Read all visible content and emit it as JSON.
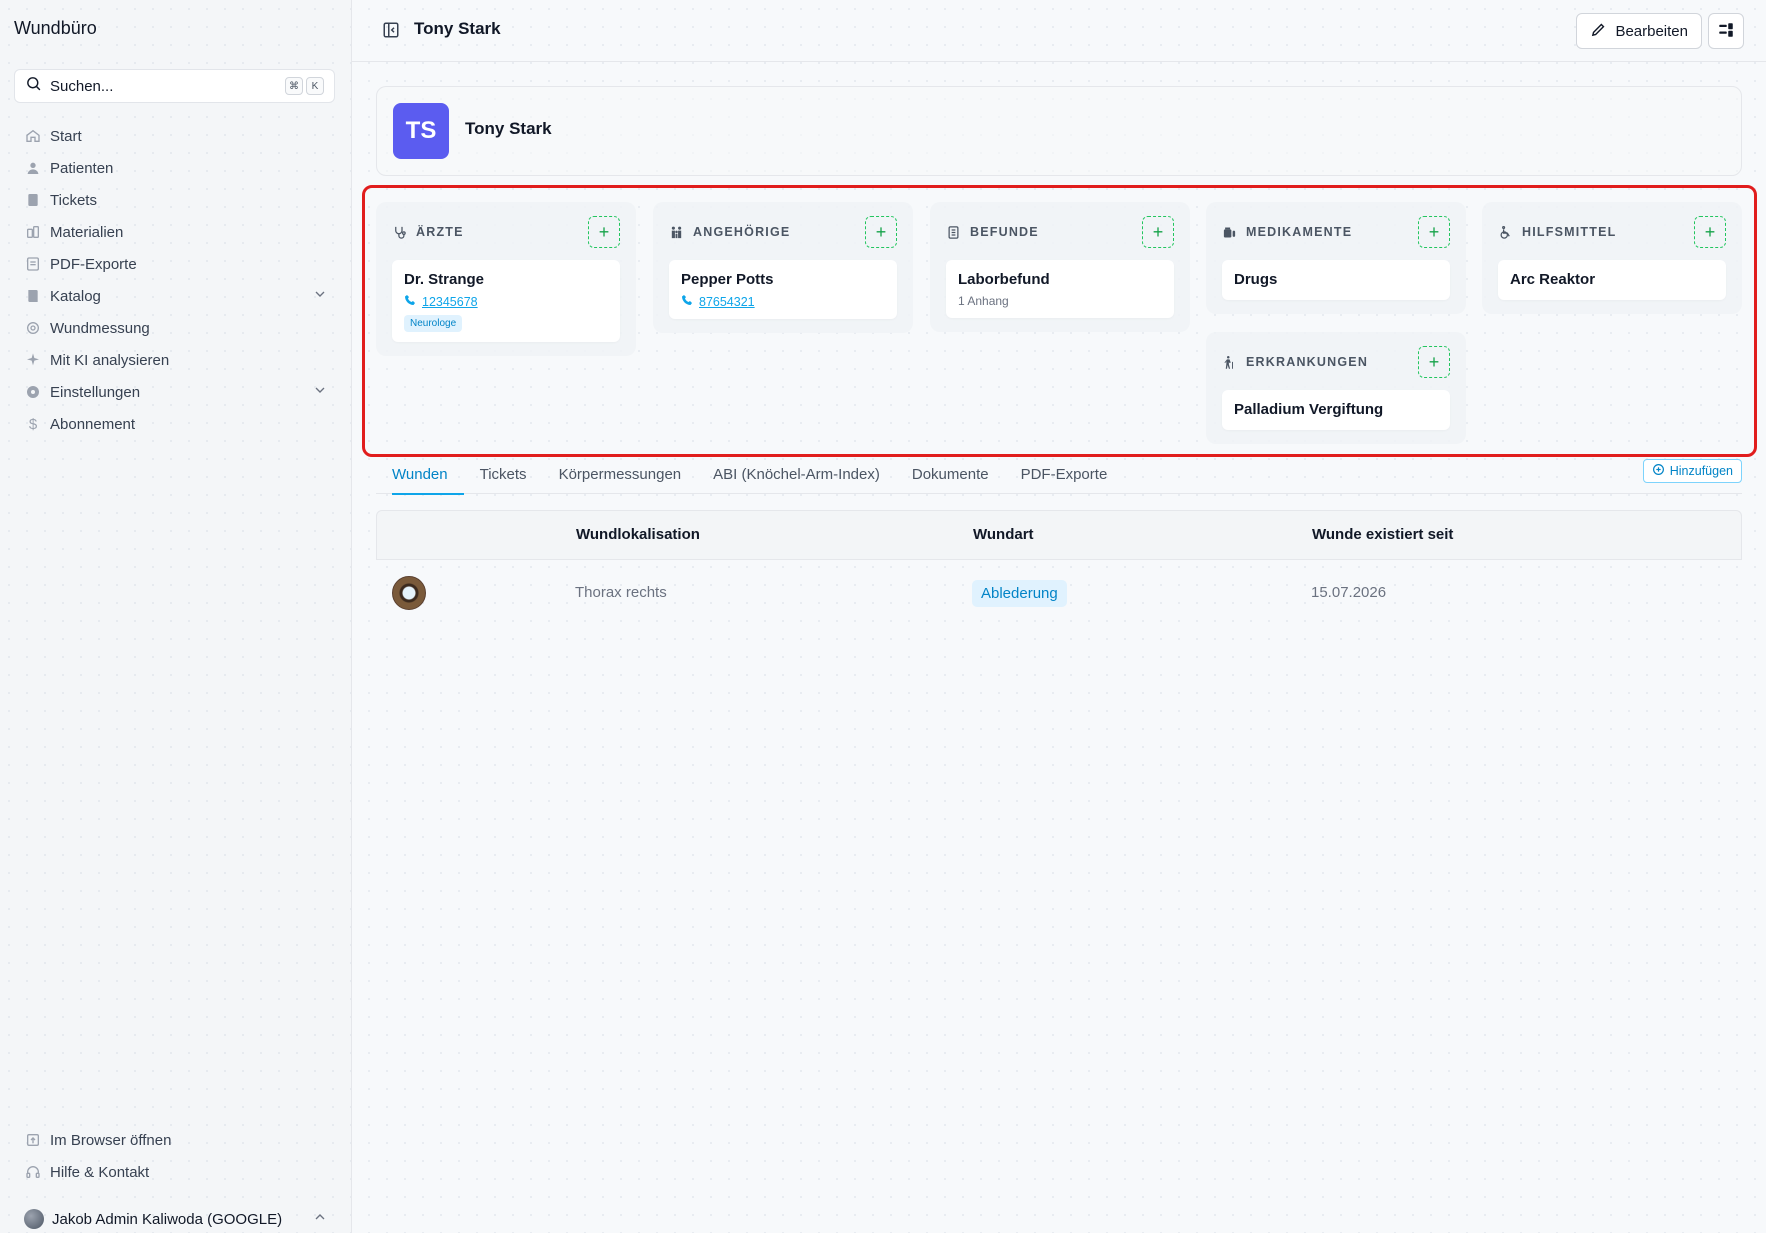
{
  "app": {
    "title": "Wundbüro"
  },
  "search": {
    "placeholder": "Suchen...",
    "shortcut_mod": "⌘",
    "shortcut_key": "K"
  },
  "sidebar": {
    "items": [
      {
        "label": "Start",
        "icon": "home-icon"
      },
      {
        "label": "Patienten",
        "icon": "user-icon"
      },
      {
        "label": "Tickets",
        "icon": "ticket-icon"
      },
      {
        "label": "Materialien",
        "icon": "materials-icon"
      },
      {
        "label": "PDF-Exporte",
        "icon": "pdf-icon"
      },
      {
        "label": "Katalog",
        "icon": "book-icon",
        "expandable": true
      },
      {
        "label": "Wundmessung",
        "icon": "measure-icon"
      },
      {
        "label": "Mit KI analysieren",
        "icon": "sparkle-icon"
      },
      {
        "label": "Einstellungen",
        "icon": "gear-icon",
        "expandable": true
      },
      {
        "label": "Abonnement",
        "icon": "dollar-icon"
      }
    ],
    "bottom_items": [
      {
        "label": "Im Browser öffnen",
        "icon": "external-icon"
      },
      {
        "label": "Hilfe & Kontakt",
        "icon": "headset-icon"
      }
    ],
    "user": {
      "name": "Jakob Admin Kaliwoda (GOOGLE)"
    }
  },
  "header": {
    "title": "Tony Stark",
    "edit_label": "Bearbeiten"
  },
  "patient": {
    "initials": "TS",
    "name": "Tony Stark",
    "avatar_color": "#5b5cf0"
  },
  "cards": {
    "aerzte": {
      "title": "ÄRZTE",
      "entries": [
        {
          "name": "Dr. Strange",
          "phone": "12345678",
          "tag": "Neurologe"
        }
      ]
    },
    "angehoerige": {
      "title": "ANGEHÖRIGE",
      "entries": [
        {
          "name": "Pepper Potts",
          "phone": "87654321"
        }
      ]
    },
    "befunde": {
      "title": "BEFUNDE",
      "entries": [
        {
          "name": "Laborbefund",
          "sub": "1 Anhang"
        }
      ]
    },
    "medikamente": {
      "title": "MEDIKAMENTE",
      "entries": [
        {
          "name": "Drugs"
        }
      ]
    },
    "hilfsmittel": {
      "title": "HILFSMITTEL",
      "entries": [
        {
          "name": "Arc Reaktor"
        }
      ]
    },
    "erkrankungen": {
      "title": "ERKRANKUNGEN",
      "entries": [
        {
          "name": "Palladium Vergiftung"
        }
      ]
    }
  },
  "tabs": {
    "items": [
      "Wunden",
      "Tickets",
      "Körpermessungen",
      "ABI (Knöchel-Arm-Index)",
      "Dokumente",
      "PDF-Exporte"
    ],
    "active": "Wunden",
    "add_label": "Hinzufügen"
  },
  "table": {
    "columns": [
      "Wundlokalisation",
      "Wundart",
      "Wunde existiert seit"
    ],
    "rows": [
      {
        "location": "Thorax rechts",
        "type": "Ablederung",
        "since": "15.07.2026"
      }
    ]
  },
  "colors": {
    "accent": "#0ea5e9",
    "add_green": "#22c55e",
    "highlight": "#e11d1d"
  }
}
